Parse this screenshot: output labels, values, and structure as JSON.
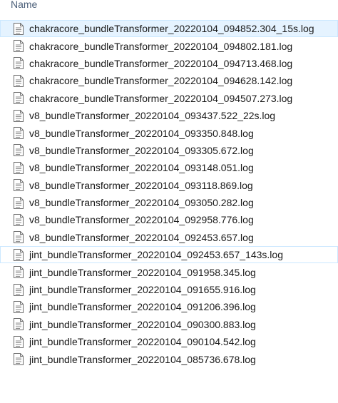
{
  "header": {
    "name_label": "Name"
  },
  "files": [
    {
      "name": "chakracore_bundleTransformer_20220104_094852.304_15s.log",
      "icon": "text-file-icon",
      "state": "selected"
    },
    {
      "name": "chakracore_bundleTransformer_20220104_094802.181.log",
      "icon": "text-file-icon",
      "state": ""
    },
    {
      "name": "chakracore_bundleTransformer_20220104_094713.468.log",
      "icon": "text-file-icon",
      "state": ""
    },
    {
      "name": "chakracore_bundleTransformer_20220104_094628.142.log",
      "icon": "text-file-icon",
      "state": ""
    },
    {
      "name": "chakracore_bundleTransformer_20220104_094507.273.log",
      "icon": "text-file-icon",
      "state": ""
    },
    {
      "name": "v8_bundleTransformer_20220104_093437.522_22s.log",
      "icon": "text-file-icon",
      "state": ""
    },
    {
      "name": "v8_bundleTransformer_20220104_093350.848.log",
      "icon": "text-file-icon",
      "state": ""
    },
    {
      "name": "v8_bundleTransformer_20220104_093305.672.log",
      "icon": "text-file-icon",
      "state": ""
    },
    {
      "name": "v8_bundleTransformer_20220104_093148.051.log",
      "icon": "text-file-icon",
      "state": ""
    },
    {
      "name": "v8_bundleTransformer_20220104_093118.869.log",
      "icon": "text-file-icon",
      "state": ""
    },
    {
      "name": "v8_bundleTransformer_20220104_093050.282.log",
      "icon": "text-file-icon",
      "state": ""
    },
    {
      "name": "v8_bundleTransformer_20220104_092958.776.log",
      "icon": "text-file-icon",
      "state": ""
    },
    {
      "name": "v8_bundleTransformer_20220104_092453.657.log",
      "icon": "text-file-icon",
      "state": ""
    },
    {
      "name": "jint_bundleTransformer_20220104_092453.657_143s.log",
      "icon": "text-file-icon",
      "state": "hovered"
    },
    {
      "name": "jint_bundleTransformer_20220104_091958.345.log",
      "icon": "text-file-icon",
      "state": ""
    },
    {
      "name": "jint_bundleTransformer_20220104_091655.916.log",
      "icon": "text-file-icon",
      "state": ""
    },
    {
      "name": "jint_bundleTransformer_20220104_091206.396.log",
      "icon": "text-file-icon",
      "state": ""
    },
    {
      "name": "jint_bundleTransformer_20220104_090300.883.log",
      "icon": "text-file-icon",
      "state": ""
    },
    {
      "name": "jint_bundleTransformer_20220104_090104.542.log",
      "icon": "text-file-icon",
      "state": ""
    },
    {
      "name": "jint_bundleTransformer_20220104_085736.678.log",
      "icon": "text-file-icon",
      "state": ""
    }
  ],
  "colors": {
    "selected_bg": "#e5f3ff",
    "selected_border": "#cce8ff",
    "header_text": "#4c607a"
  }
}
